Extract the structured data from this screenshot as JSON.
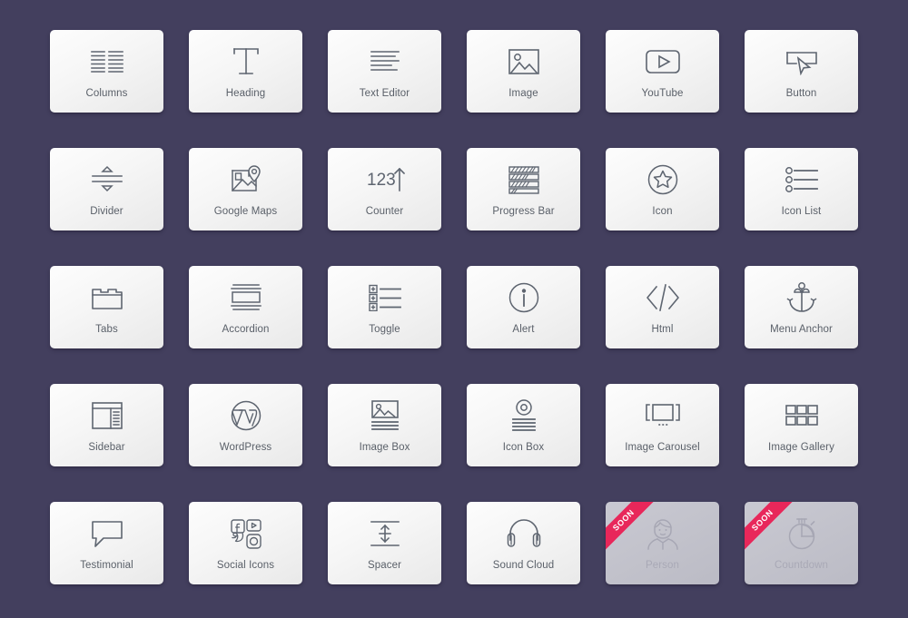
{
  "panel": {
    "background_color": "#433f5e",
    "card_color": "#f4f4f4",
    "icon_color": "#5e6570",
    "label_color": "#5a6069",
    "ribbon_color": "#e8275a",
    "disabled_card_color": "#c4c4cd",
    "columns": 6,
    "rows": 5
  },
  "widgets": [
    {
      "label": "Columns",
      "icon": "columns-icon",
      "status": "available"
    },
    {
      "label": "Heading",
      "icon": "heading-text-icon",
      "status": "available"
    },
    {
      "label": "Text Editor",
      "icon": "text-editor-icon",
      "status": "available"
    },
    {
      "label": "Image",
      "icon": "image-icon",
      "status": "available"
    },
    {
      "label": "YouTube",
      "icon": "youtube-play-icon",
      "status": "available"
    },
    {
      "label": "Button",
      "icon": "button-cursor-icon",
      "status": "available"
    },
    {
      "label": "Divider",
      "icon": "divider-icon",
      "status": "available"
    },
    {
      "label": "Google Maps",
      "icon": "google-maps-icon",
      "status": "available"
    },
    {
      "label": "Counter",
      "icon": "counter-123-icon",
      "status": "available"
    },
    {
      "label": "Progress Bar",
      "icon": "progress-bar-icon",
      "status": "available"
    },
    {
      "label": "Icon",
      "icon": "star-circle-icon",
      "status": "available"
    },
    {
      "label": "Icon List",
      "icon": "icon-list-icon",
      "status": "available"
    },
    {
      "label": "Tabs",
      "icon": "tabs-icon",
      "status": "available"
    },
    {
      "label": "Accordion",
      "icon": "accordion-icon",
      "status": "available"
    },
    {
      "label": "Toggle",
      "icon": "toggle-list-icon",
      "status": "available"
    },
    {
      "label": "Alert",
      "icon": "info-circle-icon",
      "status": "available"
    },
    {
      "label": "Html",
      "icon": "code-brackets-icon",
      "status": "available"
    },
    {
      "label": "Menu Anchor",
      "icon": "anchor-icon",
      "status": "available"
    },
    {
      "label": "Sidebar",
      "icon": "sidebar-layout-icon",
      "status": "available"
    },
    {
      "label": "WordPress",
      "icon": "wordpress-icon",
      "status": "available"
    },
    {
      "label": "Image Box",
      "icon": "image-box-icon",
      "status": "available"
    },
    {
      "label": "Icon Box",
      "icon": "icon-box-icon",
      "status": "available"
    },
    {
      "label": "Image Carousel",
      "icon": "image-carousel-icon",
      "status": "available"
    },
    {
      "label": "Image Gallery",
      "icon": "image-gallery-icon",
      "status": "available"
    },
    {
      "label": "Testimonial",
      "icon": "speech-bubble-icon",
      "status": "available"
    },
    {
      "label": "Social Icons",
      "icon": "social-icons-icon",
      "status": "available"
    },
    {
      "label": "Spacer",
      "icon": "spacer-arrows-icon",
      "status": "available"
    },
    {
      "label": "Sound Cloud",
      "icon": "headphones-icon",
      "status": "available"
    },
    {
      "label": "Person",
      "icon": "person-avatar-icon",
      "status": "coming-soon",
      "badge": "SOON"
    },
    {
      "label": "Countdown",
      "icon": "stopwatch-icon",
      "status": "coming-soon",
      "badge": "SOON"
    }
  ]
}
